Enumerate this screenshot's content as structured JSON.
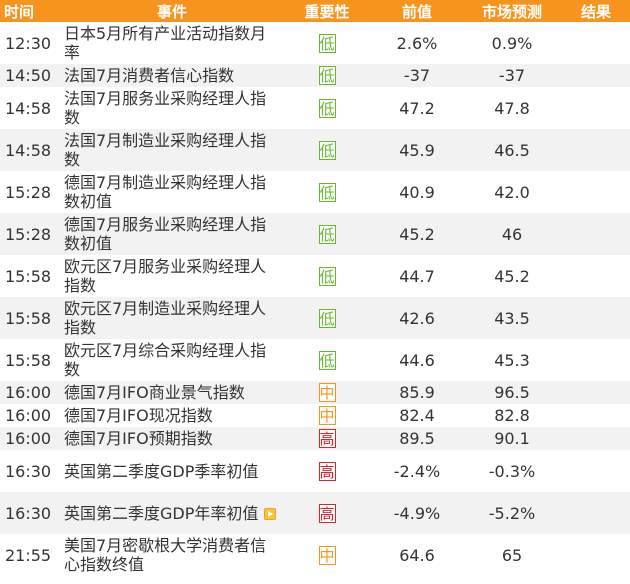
{
  "header": {
    "time": "时间",
    "event": "事件",
    "importance": "重要性",
    "previous": "前值",
    "forecast": "市场预测",
    "actual": "结果"
  },
  "colors": {
    "header_bg": "#f7941d",
    "low": "#66b82e",
    "mid": "#f7941d",
    "high": "#d9262b"
  },
  "rows": [
    {
      "time": "12:30",
      "event": "日本5月所有产业活动指数月率",
      "importance": "低",
      "level": "low",
      "previous": "2.6%",
      "forecast": "0.9%",
      "actual": ""
    },
    {
      "time": "14:50",
      "event": "法国7月消费者信心指数",
      "importance": "低",
      "level": "low",
      "previous": "-37",
      "forecast": "-37",
      "actual": ""
    },
    {
      "time": "14:58",
      "event": "法国7月服务业采购经理人指数",
      "importance": "低",
      "level": "low",
      "previous": "47.2",
      "forecast": "47.8",
      "actual": ""
    },
    {
      "time": "14:58",
      "event": "法国7月制造业采购经理人指数",
      "importance": "低",
      "level": "low",
      "previous": "45.9",
      "forecast": "46.5",
      "actual": ""
    },
    {
      "time": "15:28",
      "event": "德国7月制造业采购经理人指数初值",
      "importance": "低",
      "level": "low",
      "previous": "40.9",
      "forecast": "42.0",
      "actual": ""
    },
    {
      "time": "15:28",
      "event": "德国7月服务业采购经理人指数初值",
      "importance": "低",
      "level": "low",
      "previous": "45.2",
      "forecast": "46",
      "actual": ""
    },
    {
      "time": "15:58",
      "event": "欧元区7月服务业采购经理人指数",
      "importance": "低",
      "level": "low",
      "previous": "44.7",
      "forecast": "45.2",
      "actual": ""
    },
    {
      "time": "15:58",
      "event": "欧元区7月制造业采购经理人指数",
      "importance": "低",
      "level": "low",
      "previous": "42.6",
      "forecast": "43.5",
      "actual": ""
    },
    {
      "time": "15:58",
      "event": "欧元区7月综合采购经理人指数",
      "importance": "低",
      "level": "low",
      "previous": "44.6",
      "forecast": "45.3",
      "actual": ""
    },
    {
      "time": "16:00",
      "event": "德国7月IFO商业景气指数",
      "importance": "中",
      "level": "mid",
      "previous": "85.9",
      "forecast": "96.5",
      "actual": ""
    },
    {
      "time": "16:00",
      "event": "德国7月IFO现况指数",
      "importance": "中",
      "level": "mid",
      "previous": "82.4",
      "forecast": "82.8",
      "actual": ""
    },
    {
      "time": "16:00",
      "event": "德国7月IFO预期指数",
      "importance": "高",
      "level": "high",
      "previous": "89.5",
      "forecast": "90.1",
      "actual": ""
    },
    {
      "time": "16:30",
      "event": "英国第二季度GDP季率初值",
      "importance": "高",
      "level": "high",
      "previous": "-2.4%",
      "forecast": "-0.3%",
      "actual": ""
    },
    {
      "time": "16:30",
      "event": "英国第二季度GDP年率初值",
      "importance": "高",
      "level": "high",
      "previous": "-4.9%",
      "forecast": "-5.2%",
      "actual": "",
      "play_icon": true
    },
    {
      "time": "21:55",
      "event": "美国7月密歇根大学消费者信心指数终值",
      "importance": "中",
      "level": "mid",
      "previous": "64.6",
      "forecast": "65",
      "actual": ""
    }
  ]
}
